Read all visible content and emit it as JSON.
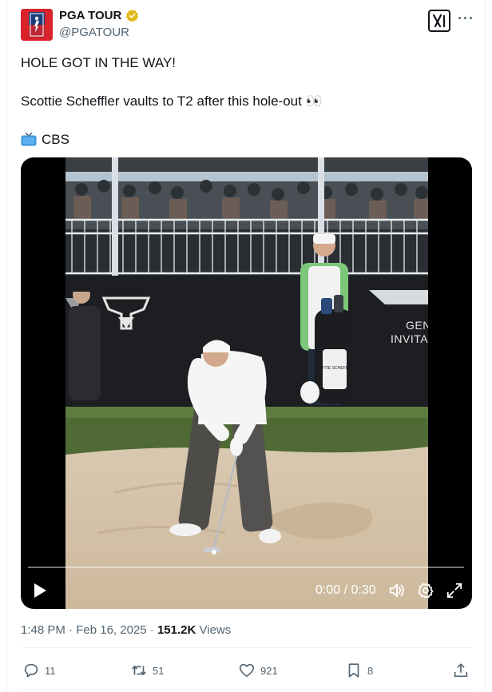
{
  "author": {
    "name": "PGA TOUR",
    "handle": "@PGATOUR",
    "verified": true
  },
  "post": {
    "lines": [
      "HOLE GOT IN THE WAY!",
      "",
      "Scottie Scheffler vaults to T2 after this hole-out 👀",
      "",
      "CBS"
    ]
  },
  "video": {
    "time": "0:00 / 0:30",
    "signage": {
      "left_brand": "GEN",
      "left_brand_2": "INVITA"
    },
    "bag_text": "SCOTTIE SCHEFFLER"
  },
  "meta": {
    "time": "1:48 PM",
    "date": "Feb 16, 2025",
    "views_count": "151.2K",
    "views_label": "Views"
  },
  "actions": {
    "replies": "11",
    "reposts": "51",
    "likes": "921",
    "bookmarks": "8"
  },
  "colors": {
    "text": "#0f1419",
    "secondary": "#536471",
    "brand_red": "#d8232a",
    "verified_gold": "#e2b719"
  },
  "icons": [
    "pga-tour-logo",
    "verified-badge-icon",
    "grok-icon",
    "more-icon",
    "tv-icon",
    "play-icon",
    "volume-icon",
    "settings-icon",
    "fullscreen-icon",
    "reply-icon",
    "repost-icon",
    "like-icon",
    "bookmark-icon",
    "share-icon"
  ]
}
